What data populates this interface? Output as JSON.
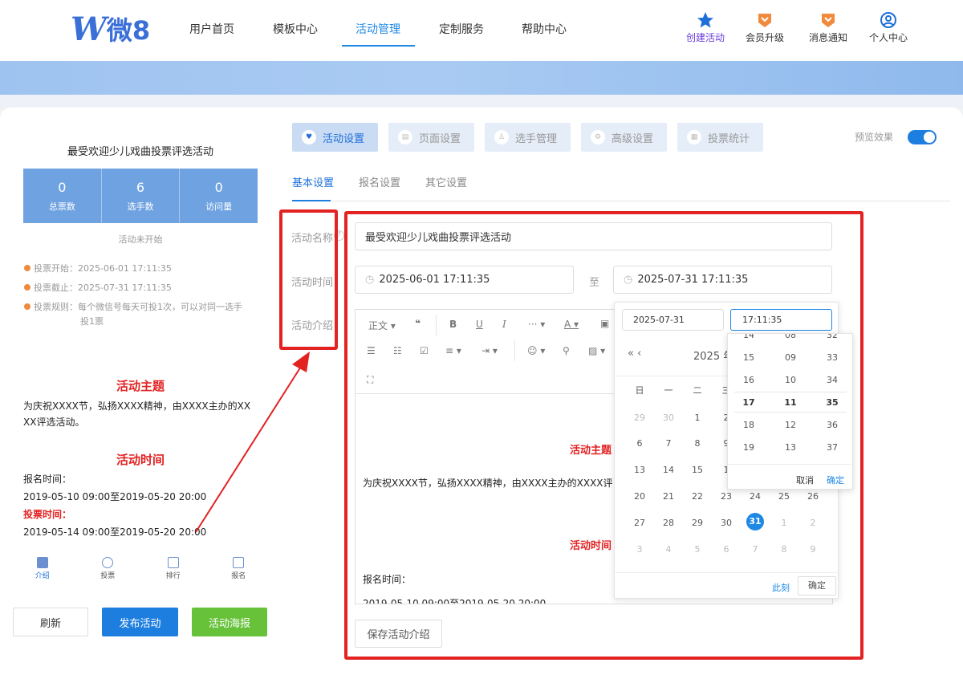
{
  "header": {
    "logo_w": "W",
    "logo_text": "微8",
    "nav": [
      "用户首页",
      "模板中心",
      "活动管理",
      "定制服务",
      "帮助中心"
    ],
    "right_icons": [
      {
        "label": "创建活动",
        "icon": "star-icon",
        "color": "#6a3fd8"
      },
      {
        "label": "会员升级",
        "icon": "vip-badge-icon",
        "color": "#f08a3c"
      },
      {
        "label": "消息通知",
        "icon": "message-badge-icon",
        "color": "#f08a3c"
      },
      {
        "label": "个人中心",
        "icon": "user-circle-icon",
        "color": "#1e88e5"
      }
    ]
  },
  "preview": {
    "title": "最受欢迎少儿戏曲投票评选活动",
    "stats": [
      {
        "value": "0",
        "label": "总票数"
      },
      {
        "value": "6",
        "label": "选手数"
      },
      {
        "value": "0",
        "label": "访问量"
      }
    ],
    "status": "活动未开始",
    "info": [
      "投票开始：2025-06-01 17:11:35",
      "投票截止：2025-07-31 17:11:35",
      "投票规则：每个微信号每天可投1次，可以对同一选手"
    ],
    "info_cont": "投1票",
    "theme_heading": "活动主题",
    "theme_text1": "为庆祝XXXX节，弘扬XXXX精神，由XXXX主办的XX",
    "theme_text2": "XX评选活动。",
    "time_heading": "活动时间",
    "signup_label": "报名时间：",
    "signup_range": "2019-05-10 09:00至2019-05-20 20:00",
    "vote_label": "投票时间：",
    "vote_range": "2019-05-14 09:00至2019-05-20 20:00",
    "tabs": [
      "介绍",
      "投票",
      "排行",
      "报名"
    ]
  },
  "buttons": {
    "refresh": "刷新",
    "publish": "发布活动",
    "poster": "活动海报",
    "save_intro": "保存活动介绍"
  },
  "top_tabs": [
    "活动设置",
    "页面设置",
    "选手管理",
    "高级设置",
    "投票统计"
  ],
  "preview_toggle": "预览效果",
  "sub_tabs": [
    "基本设置",
    "报名设置",
    "其它设置"
  ],
  "form": {
    "name_label": "活动名称",
    "name_value": "最受欢迎少儿戏曲投票评选活动",
    "time_label": "活动时间",
    "start": "2025-06-01 17:11:35",
    "to": "至",
    "end": "2025-07-31 17:11:35",
    "intro_label": "活动介绍"
  },
  "editor": {
    "toolbar_row1": [
      "正文",
      "❝",
      "B",
      "U",
      "I",
      "···",
      "A",
      "▣"
    ],
    "content_theme": "活动主题",
    "content_text": "为庆祝XXXX节，弘扬XXXX精神，由XXXX主办的XXXX评",
    "content_time": "活动时间",
    "content_signup": "报名时间：",
    "content_range": "2019-05-10 09:00至2019-05-20 20:00"
  },
  "datepicker": {
    "date_value": "2025-07-31",
    "time_value": "17:11:35",
    "nav_prev": "«  ‹",
    "month_title": "2025 年",
    "weekdays": [
      "日",
      "一",
      "二",
      "三"
    ],
    "rows": [
      [
        "29",
        "30",
        "1",
        "2"
      ],
      [
        "6",
        "7",
        "8",
        "9"
      ],
      [
        "13",
        "14",
        "15",
        "1"
      ],
      [
        "20",
        "21",
        "22",
        "23",
        "24",
        "25",
        "26"
      ],
      [
        "27",
        "28",
        "29",
        "30",
        "31",
        "1",
        "2"
      ],
      [
        "3",
        "4",
        "5",
        "6",
        "7",
        "8",
        "9"
      ]
    ],
    "now": "此刻",
    "ok": "确定"
  },
  "timepicker": {
    "hours": [
      "14",
      "15",
      "16",
      "17",
      "18",
      "19"
    ],
    "minutes": [
      "08",
      "09",
      "10",
      "11",
      "12",
      "13"
    ],
    "seconds": [
      "32",
      "33",
      "34",
      "35",
      "36",
      "37"
    ],
    "cancel": "取消",
    "ok": "确定"
  }
}
